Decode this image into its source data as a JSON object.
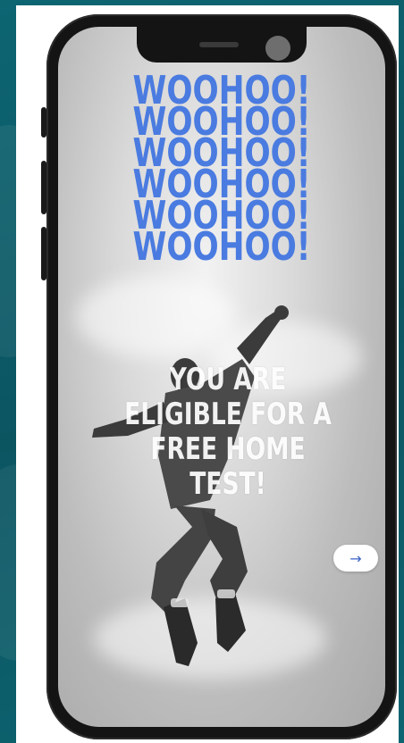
{
  "screen": {
    "woohoo_lines": [
      "WOOHOO!",
      "WOOHOO!",
      "WOOHOO!",
      "WOOHOO!",
      "WOOHOO!",
      "WOOHOO!"
    ],
    "headline": "YOU ARE ELIGIBLE FOR A FREE HOME TEST!",
    "next_button_icon": "arrow-right-icon",
    "next_button_glyph": "→"
  },
  "colors": {
    "accent_blue": "#4a7be0",
    "background_teal": "#0c5c6a",
    "headline_white": "#ffffff"
  }
}
